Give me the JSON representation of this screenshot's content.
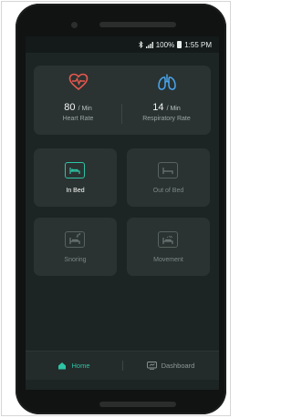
{
  "statusbar": {
    "bluetooth_icon": "bluetooth-icon",
    "signal_icon": "signal-icon",
    "battery_text": "100%",
    "time": "1:55 PM"
  },
  "vitals": {
    "heart_rate": {
      "icon": "heart-pulse-icon",
      "value": "80",
      "unit": "/ Min",
      "label": "Heart Rate",
      "color": "#e8584e"
    },
    "respiratory_rate": {
      "icon": "lungs-icon",
      "value": "14",
      "unit": "/ Min",
      "label": "Respiratory Rate",
      "color": "#4aa6f0"
    }
  },
  "tiles": [
    {
      "label": "In Bed",
      "icon": "bed-icon",
      "active": true
    },
    {
      "label": "Out of Bed",
      "icon": "empty-bed-icon",
      "active": false
    },
    {
      "label": "Snoring",
      "icon": "snoring-icon",
      "active": false
    },
    {
      "label": "Movement",
      "icon": "movement-icon",
      "active": false
    }
  ],
  "tabbar": {
    "home_label": "Home",
    "dashboard_label": "Dashboard",
    "active": "Home"
  },
  "colors": {
    "accent": "#2ec4a5",
    "background": "#1d2524",
    "card": "#2a3332"
  }
}
